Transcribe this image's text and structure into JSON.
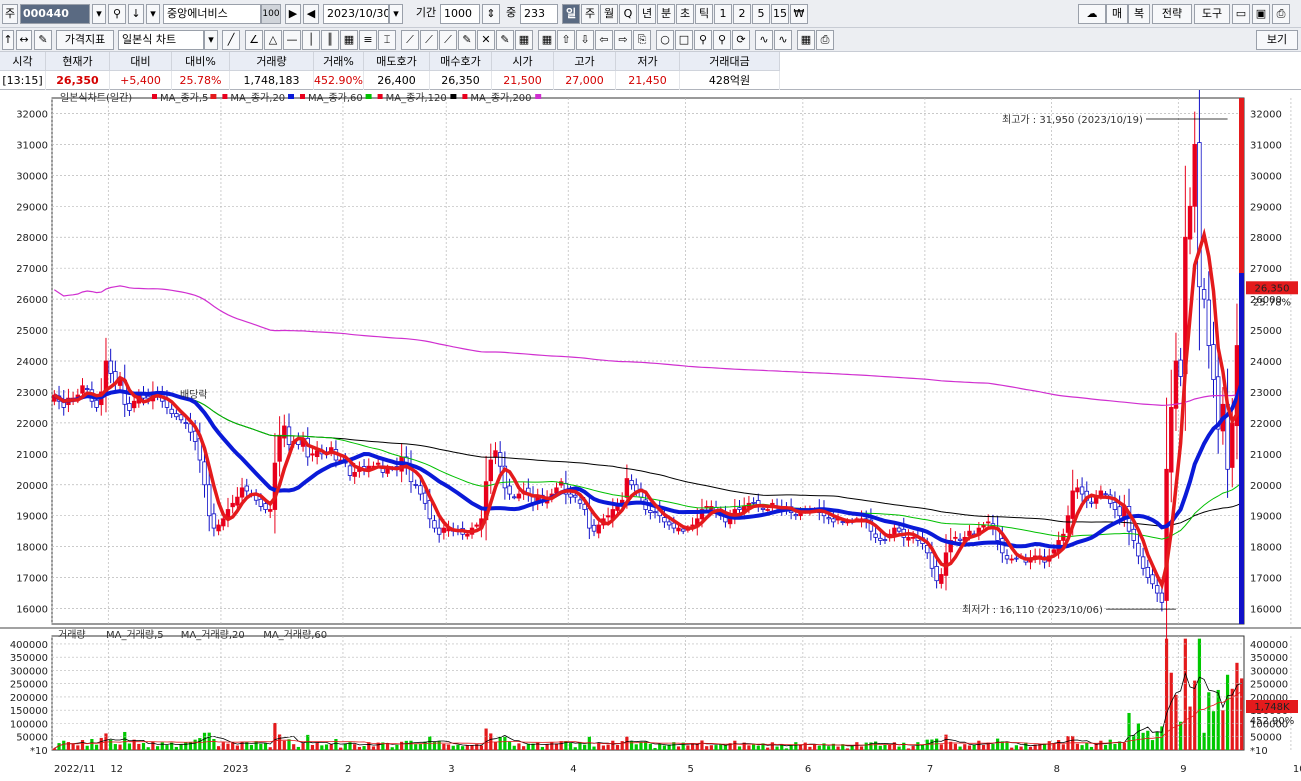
{
  "toolbar": {
    "market_tab": "주",
    "stock_code": "000440",
    "stock_name": "중앙에너비스",
    "stock_count_badge": "100",
    "date": "2023/10/30",
    "period_label": "기간",
    "period_value": "1000",
    "overlap_label": "중",
    "overlap_value": "233",
    "interval_tabs": [
      "일",
      "주",
      "월",
      "Q",
      "년",
      "분",
      "초",
      "틱",
      "1",
      "2",
      "5",
      "15",
      "₩"
    ],
    "selected_interval": "일",
    "right_buttons": [
      "매",
      "복",
      "전략",
      "도구"
    ],
    "view_label": "보기"
  },
  "toolbar2": {
    "indicator_button": "가격지표",
    "chart_type_select": "일본식 차트"
  },
  "quote": {
    "headers": [
      "시각",
      "현재가",
      "대비",
      "대비%",
      "거래량",
      "거래%",
      "매도호가",
      "매수호가",
      "시가",
      "고가",
      "저가",
      "거래대금"
    ],
    "values": [
      "[13:15]",
      "26,350",
      "+5,400",
      "25.78%",
      "1,748,183",
      "452.90%",
      "26,400",
      "26,350",
      "21,500",
      "27,000",
      "21,450",
      "428억원"
    ],
    "colors": [
      "#000000",
      "#d40000",
      "#d40000",
      "#d40000",
      "#000000",
      "#d40000",
      "#000000",
      "#000000",
      "#d40000",
      "#d40000",
      "#d40000",
      "#000000"
    ]
  },
  "colors": {
    "up": "#e8001c",
    "down": "#1010c8",
    "ma5": "#e41a1c",
    "ma20": "#0a1ad8",
    "ma60": "#00c000",
    "ma120": "#000000",
    "ma200": "#d030d0",
    "vol_up": "#e41a1c",
    "vol_down": "#00c800",
    "grid": "#b8b8b8"
  },
  "chart_data": [
    {
      "type": "candlestick",
      "title": "일본식차트(일간)",
      "legend": [
        "MA_종가,5",
        "MA_종가,20",
        "MA_종가,60",
        "MA_종가,120",
        "MA_종가,200"
      ],
      "ylim": [
        15500,
        32500
      ],
      "y_ticks": [
        16000,
        17000,
        18000,
        19000,
        20000,
        21000,
        22000,
        23000,
        24000,
        25000,
        26000,
        27000,
        28000,
        29000,
        30000,
        31000,
        32000
      ],
      "x_tick_labels": [
        "2022/11",
        "12",
        "2023",
        "2",
        "3",
        "4",
        "5",
        "6",
        "7",
        "8",
        "9",
        "10"
      ],
      "x_tick_positions": [
        0,
        12,
        36,
        62,
        84,
        110,
        135,
        160,
        186,
        213,
        240,
        264
      ],
      "closes": [
        22900,
        22700,
        22500,
        22800,
        22800,
        22900,
        23200,
        23100,
        22700,
        22500,
        23000,
        24000,
        23600,
        23300,
        23400,
        22600,
        22400,
        22700,
        22900,
        22800,
        22800,
        23000,
        22900,
        22700,
        22500,
        22300,
        22200,
        22100,
        22000,
        21700,
        21400,
        20800,
        20000,
        19000,
        18600,
        18700,
        18900,
        19200,
        19400,
        19600,
        19900,
        19800,
        19700,
        19500,
        19300,
        19200,
        19200,
        20700,
        21600,
        21900,
        21300,
        21400,
        21300,
        21500,
        20900,
        21000,
        21100,
        21000,
        21000,
        21200,
        20800,
        20800,
        20700,
        20300,
        20400,
        20500,
        20500,
        20600,
        20600,
        20700,
        20400,
        20500,
        20500,
        20500,
        20900,
        20600,
        20100,
        20000,
        19700,
        19400,
        18900,
        18600,
        18400,
        18600,
        18600,
        18500,
        18500,
        18400,
        18400,
        18600,
        18700,
        18900,
        20100,
        20800,
        21100,
        20600,
        19900,
        19700,
        19600,
        19700,
        19800,
        19700,
        19400,
        19600,
        19500,
        19600,
        19700,
        19900,
        20100,
        19700,
        19600,
        19600,
        19400,
        19200,
        18600,
        18500,
        18700,
        18900,
        19000,
        19200,
        19300,
        19500,
        20200,
        20000,
        19800,
        19600,
        19200,
        19100,
        19100,
        19000,
        18800,
        18700,
        18600,
        18600,
        18500,
        18600,
        18700,
        18900,
        19200,
        19300,
        19300,
        19100,
        19000,
        18800,
        19000,
        19200,
        19200,
        19300,
        19400,
        19400,
        19300,
        19200,
        19200,
        19400,
        19300,
        19200,
        19200,
        19100,
        19000,
        19100,
        19200,
        19200,
        19200,
        19100,
        19000,
        18900,
        18800,
        18900,
        18800,
        18800,
        18800,
        18900,
        18900,
        18800,
        18500,
        18300,
        18200,
        18200,
        18400,
        18600,
        18500,
        18300,
        18300,
        18300,
        18200,
        18100,
        17800,
        17300,
        16900,
        17100,
        17800,
        18200,
        18300,
        18200,
        18300,
        18500,
        18400,
        18600,
        18700,
        18800,
        18600,
        18200,
        17800,
        17600,
        17600,
        17600,
        17700,
        17500,
        17600,
        17700,
        17700,
        17500,
        17700,
        17900,
        18200,
        18400,
        19000,
        19800,
        19900,
        19700,
        19500,
        19400,
        19600,
        19800,
        19700,
        19400,
        19200,
        19000,
        19300,
        18500,
        18200,
        17700,
        17300,
        17000,
        16800,
        16500,
        16200,
        20500,
        22500,
        24000,
        23500,
        28000,
        29000,
        31000,
        26400,
        26000,
        24500,
        23400,
        21800,
        22600,
        20500,
        22000,
        24500,
        26350
      ],
      "ma_series": {
        "MA_종가,5": "computed from closes",
        "MA_종가,20": "computed from closes",
        "MA_종가,60": "computed from closes",
        "MA_종가,120": "computed from closes",
        "MA_종가,200": "computed from closes"
      },
      "annotations": [
        {
          "text": "최고가 : 31,950 (2023/10/19)",
          "value": 31950,
          "color": "#d40000"
        },
        {
          "text": "최저가 : 16,110 (2023/10/06)",
          "value": 16110,
          "color": "#1010c8"
        },
        {
          "text": "배당락",
          "value": 22800,
          "color": "#000000"
        }
      ],
      "current_price_label": "26,350",
      "current_change_label": "25.78%"
    },
    {
      "type": "bar",
      "title": "거래량",
      "legend": [
        "MA_거래량,5",
        "MA_거래량,20",
        "MA_거래량,60"
      ],
      "ylim": [
        0,
        430000
      ],
      "y_ticks": [
        50000,
        100000,
        150000,
        200000,
        250000,
        300000,
        350000,
        400000
      ],
      "y_tick_labels": [
        "50000",
        "100000",
        "150000",
        "200000",
        "250000",
        "300000",
        "350000",
        "400000"
      ],
      "multiplier_label": "*10",
      "current_volume_label": "1,748K",
      "current_volume_pct": "452.90%"
    }
  ]
}
